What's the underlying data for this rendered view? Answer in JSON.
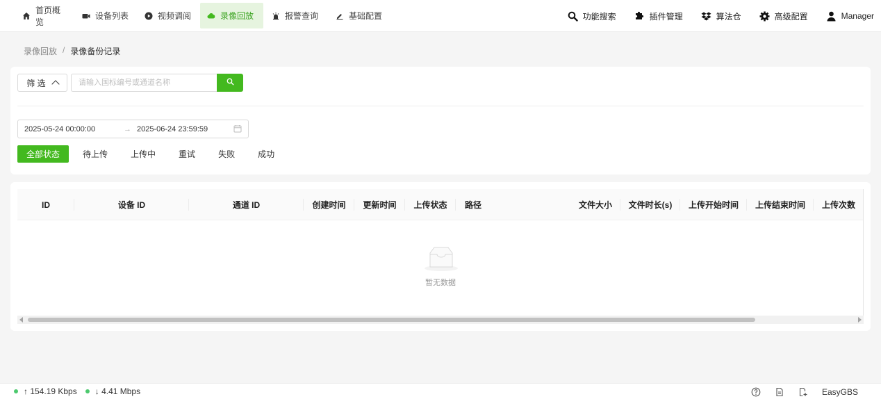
{
  "nav": {
    "items": [
      {
        "label": "首页概览",
        "icon": "home-icon"
      },
      {
        "label": "设备列表",
        "icon": "camera-icon"
      },
      {
        "label": "视频调阅",
        "icon": "play-circle-icon"
      },
      {
        "label": "录像回放",
        "icon": "cloud-icon",
        "active": true
      },
      {
        "label": "报警查询",
        "icon": "alarm-icon"
      },
      {
        "label": "基础配置",
        "icon": "edit-icon"
      }
    ],
    "right": [
      {
        "label": "功能搜索",
        "icon": "search-icon"
      },
      {
        "label": "插件管理",
        "icon": "puzzle-icon"
      },
      {
        "label": "算法仓",
        "icon": "dropbox-icon"
      },
      {
        "label": "高级配置",
        "icon": "gear-icon"
      },
      {
        "label": "Manager",
        "icon": "user-icon"
      }
    ],
    "accent": "#43b91f"
  },
  "breadcrumb": {
    "parent": "录像回放",
    "separator": "/",
    "current": "录像备份记录"
  },
  "filter": {
    "toggle_label": "筛 选",
    "search_placeholder": "请输入国标编号或通道名称",
    "search_value": "",
    "date_start": "2025-05-24 00:00:00",
    "date_arrow": "→",
    "date_end": "2025-06-24 23:59:59",
    "status_tabs": [
      "全部状态",
      "待上传",
      "上传中",
      "重试",
      "失败",
      "成功"
    ],
    "active_status": "全部状态"
  },
  "table": {
    "columns": [
      "ID",
      "设备 ID",
      "通道 ID",
      "创建时间",
      "更新时间",
      "上传状态",
      "路径",
      "文件大小",
      "文件时长(s)",
      "上传开始时间",
      "上传结束时间",
      "上传次数"
    ],
    "rows": [],
    "empty_text": "暂无数据"
  },
  "footer": {
    "upload_rate": "↑ 154.19 Kbps",
    "download_rate": "↓ 4.41 Mbps",
    "brand": "EasyGBS",
    "status_color": "#4cc96e"
  }
}
